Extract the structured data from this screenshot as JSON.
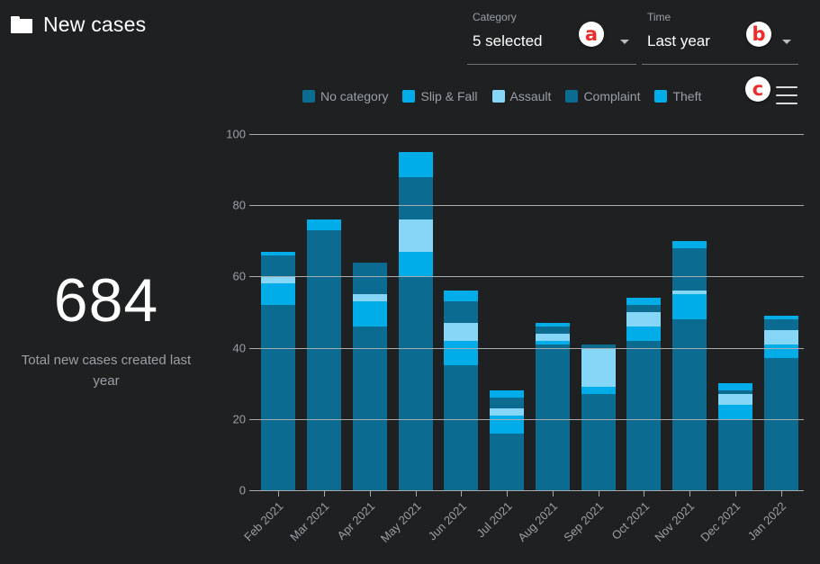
{
  "header": {
    "icon": "folder-icon",
    "title": "New cases"
  },
  "filters": {
    "category": {
      "label": "Category",
      "value": "5 selected",
      "caret": "chevron-down-icon"
    },
    "time": {
      "label": "Time",
      "value": "Last year",
      "caret": "chevron-down-icon"
    }
  },
  "annotations": [
    {
      "id": "a",
      "letter": "a",
      "color": "#ee2b2b"
    },
    {
      "id": "b",
      "letter": "b",
      "color": "#ee2b2b"
    },
    {
      "id": "c",
      "letter": "c",
      "color": "#ee2b2b"
    }
  ],
  "menu": {
    "name": "hamburger-menu-icon"
  },
  "kpi": {
    "value": "684",
    "caption": "Total new cases created last year"
  },
  "colors": {
    "background": "#1e2022",
    "grid": "#a8abad",
    "text_muted": "#9aa0a6",
    "no_category": "#0b6b91",
    "slip_and_fall": "#00ade8",
    "assault": "#86d6f7",
    "complaint": "#0b6b91",
    "theft": "#00ade8"
  },
  "chart_data": {
    "type": "bar",
    "stacked": true,
    "title": "",
    "xlabel": "",
    "ylabel": "",
    "ylim": [
      0,
      100
    ],
    "yticks": [
      0,
      20,
      40,
      60,
      80,
      100
    ],
    "grid": true,
    "legend_position": "top",
    "categories": [
      "Feb 2021",
      "Mar 2021",
      "Apr 2021",
      "May 2021",
      "Jun 2021",
      "Jul 2021",
      "Aug 2021",
      "Sep 2021",
      "Oct 2021",
      "Nov 2021",
      "Dec 2021",
      "Jan 2022"
    ],
    "series": [
      {
        "name": "No category",
        "color": "#0b6b91",
        "values": [
          52,
          64,
          46,
          60,
          35,
          16,
          41,
          27,
          42,
          48,
          20,
          37
        ]
      },
      {
        "name": "Slip & Fall",
        "color": "#00ade8",
        "values": [
          6,
          0,
          7,
          7,
          7,
          5,
          1,
          2,
          4,
          7,
          4,
          4
        ]
      },
      {
        "name": "Assault",
        "color": "#86d6f7",
        "values": [
          2,
          0,
          2,
          9,
          5,
          2,
          2,
          11,
          4,
          1,
          3,
          4
        ]
      },
      {
        "name": "Complaint",
        "color": "#0b6b91",
        "values": [
          6,
          9,
          9,
          12,
          6,
          3,
          2,
          1,
          2,
          12,
          1,
          3
        ]
      },
      {
        "name": "Theft",
        "color": "#00ade8",
        "values": [
          1,
          3,
          0,
          7,
          3,
          2,
          1,
          0,
          2,
          2,
          2,
          1
        ]
      }
    ],
    "totals": [
      67,
      76,
      64,
      95,
      56,
      28,
      47,
      41,
      54,
      70,
      30,
      49
    ]
  }
}
